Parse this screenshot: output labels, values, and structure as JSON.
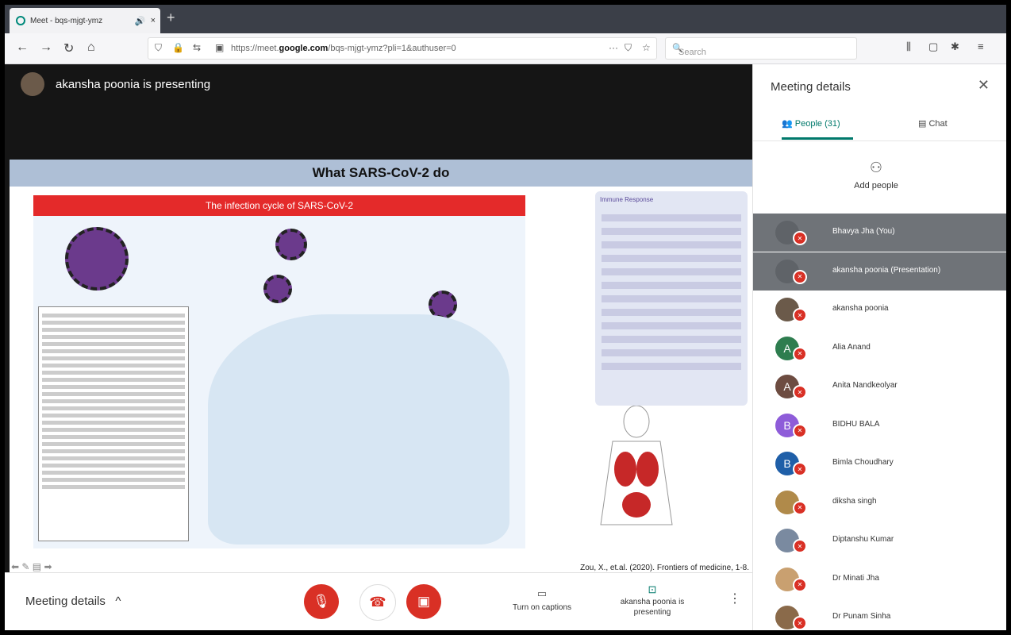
{
  "browser": {
    "tab_title": "Meet - bqs-mjgt-ymz",
    "tab_sound": "🔊",
    "tab_close": "×",
    "new_tab": "+",
    "url_prefix": "https://meet.",
    "url_domain": "google.com",
    "url_suffix": "/bqs-mjgt-ymz?pli=1&authuser=0",
    "search_placeholder": "Search",
    "url_more": "···"
  },
  "stage": {
    "presenter_text": "akansha poonia is presenting"
  },
  "slide": {
    "title": "What SARS-CoV-2 do",
    "poster_title": "The infection cycle of SARS-CoV-2",
    "immune_title": "Immune Response",
    "citation": "Zou, X., et.al. (2020). Frontiers of medicine, 1-8."
  },
  "bottom": {
    "meeting_details": "Meeting details",
    "captions_label": "Turn on captions",
    "presenting_label": "akansha poonia is presenting"
  },
  "panel": {
    "title": "Meeting details",
    "tab_people": "People (31)",
    "tab_chat": "Chat",
    "add_people": "Add people",
    "people": [
      {
        "name": "Bhavya Jha (You)",
        "initial": "",
        "color": "#5f6368"
      },
      {
        "name": "akansha poonia (Presentation)",
        "initial": "",
        "color": "#5f6368"
      },
      {
        "name": "akansha poonia",
        "initial": "",
        "color": "#6b5a4a"
      },
      {
        "name": "Alia Anand",
        "initial": "A",
        "color": "#2e7d4f"
      },
      {
        "name": "Anita Nandkeolyar",
        "initial": "A",
        "color": "#6d4c41"
      },
      {
        "name": "BIDHU BALA",
        "initial": "B",
        "color": "#8e5cd9"
      },
      {
        "name": "Bimla Choudhary",
        "initial": "B",
        "color": "#1f5fa8"
      },
      {
        "name": "diksha singh",
        "initial": "",
        "color": "#b08a4a"
      },
      {
        "name": "Diptanshu Kumar",
        "initial": "",
        "color": "#7a8aa0"
      },
      {
        "name": "Dr Minati Jha",
        "initial": "",
        "color": "#c9a070"
      },
      {
        "name": "Dr Punam Sinha",
        "initial": "",
        "color": "#8a6a4a"
      }
    ]
  }
}
